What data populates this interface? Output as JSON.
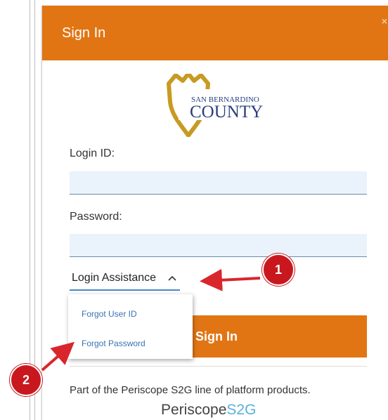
{
  "modal": {
    "title": "Sign In",
    "close_glyph": "×"
  },
  "logo": {
    "line1": "SAN BERNARDINO",
    "line2": "COUNTY"
  },
  "form": {
    "login_id_label": "Login ID:",
    "login_id_value": "",
    "password_label": "Password:",
    "password_value": "",
    "assist_label": "Login Assistance",
    "signin_label": "Sign In"
  },
  "dropdown": {
    "items": [
      {
        "label": "Forgot User ID"
      },
      {
        "label": "Forgot Password"
      }
    ]
  },
  "footer": {
    "text": "Part of the Periscope S2G line of platform products.",
    "brand_part1": "Periscope",
    "brand_part2": "S2G"
  },
  "callouts": {
    "badge1": "1",
    "badge2": "2"
  },
  "colors": {
    "accent": "#e17514",
    "link": "#3a72b5",
    "callout": "#c8181e",
    "input_bg": "#eaf3fb",
    "brand_s2g": "#5bb0d8"
  }
}
